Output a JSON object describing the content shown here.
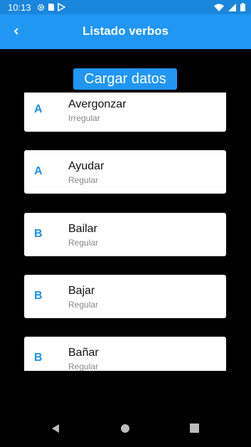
{
  "status_bar": {
    "time": "10:13",
    "icons_left": [
      "gear-icon",
      "sim-card-icon",
      "play-store-icon"
    ],
    "icons_right": [
      "wifi-icon",
      "signal-icon",
      "battery-icon"
    ]
  },
  "app_bar": {
    "title": "Listado verbos",
    "back_icon": "back-arrow-icon",
    "color": "#2196f3"
  },
  "load_button": {
    "label": "Cargar datos"
  },
  "verbs": [
    {
      "letter": "A",
      "name": "Avergonzar",
      "type": "Irregular"
    },
    {
      "letter": "A",
      "name": "Ayudar",
      "type": "Regular"
    },
    {
      "letter": "B",
      "name": "Bailar",
      "type": "Regular"
    },
    {
      "letter": "B",
      "name": "Bajar",
      "type": "Regular"
    },
    {
      "letter": "B",
      "name": "Bañar",
      "type": "Regular"
    }
  ],
  "nav_bar": {
    "icons": [
      "back-triangle-icon",
      "home-circle-icon",
      "recents-square-icon"
    ]
  }
}
